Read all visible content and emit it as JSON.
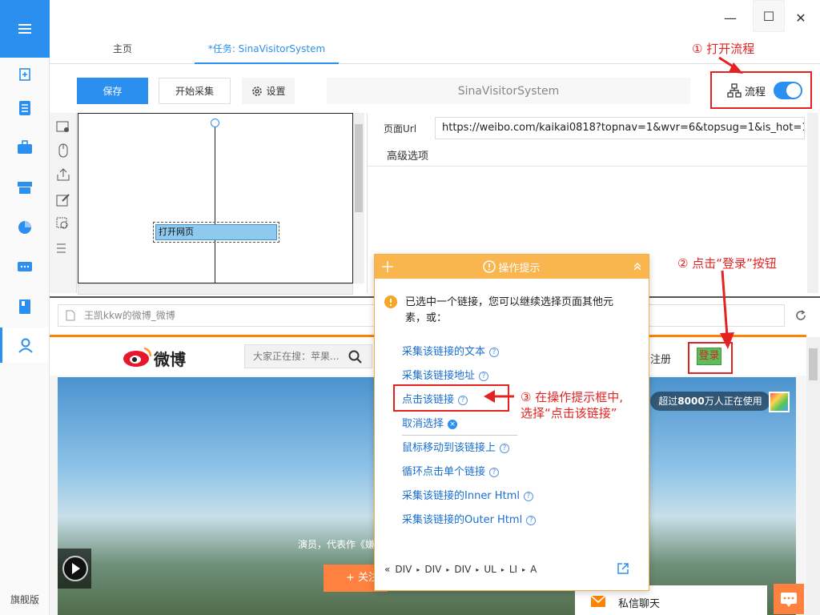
{
  "sidebar": {
    "edition_label": "旗舰版"
  },
  "tabs": [
    {
      "label": "主页"
    },
    {
      "label": "*任务: SinaVisitorSystem"
    }
  ],
  "toolbar": {
    "save_label": "保存",
    "start_label": "开始采集",
    "settings_label": "设置",
    "task_name": "SinaVisitorSystem",
    "flow_label": "流程"
  },
  "flow": {
    "node_label": "打开网页"
  },
  "right": {
    "url_label": "页面Url",
    "url_value": "https://weibo.com/kaikai0818?topnav=1&wvr=6&topsug=1&is_hot=1",
    "advanced_label": "高级选项"
  },
  "browser": {
    "tab_title": "王凯kkw的微博_微博",
    "weibo_logo": "微博",
    "search_placeholder": "大家正在搜：苹果...",
    "register": "注册",
    "login": "登录",
    "users_text_pre": "超过",
    "users_count": "8000",
    "users_text_post": "万人正在使用",
    "caption": "演员，代表作《嫌",
    "follow_btn": "+ 关注",
    "chat_label": "私信聊天"
  },
  "popup": {
    "title": "操作提示",
    "message": "已选中一个链接，您可以继续选择页面其他元素，或：",
    "options": [
      {
        "label": "采集该链接的文本"
      },
      {
        "label": "采集该链接地址"
      },
      {
        "label": "点击该链接"
      },
      {
        "label": "取消选择"
      },
      {
        "label": "鼠标移动到该链接上"
      },
      {
        "label": "循环点击单个链接"
      },
      {
        "label": "采集该链接的Inner Html"
      },
      {
        "label": "采集该链接的Outer Html"
      }
    ],
    "breadcrumb": [
      "DIV",
      "DIV",
      "DIV",
      "UL",
      "LI",
      "A"
    ]
  },
  "annotations": {
    "a1": "① 打开流程",
    "a2": "② 点击“登录”按钮",
    "a3_line1": "③ 在操作提示框中,",
    "a3_line2": "选择“点击该链接”"
  },
  "colors": {
    "accent": "#2b8ff0",
    "popup_header": "#f9b54e",
    "annotation": "#e52222",
    "weibo_orange": "#ff8200"
  }
}
